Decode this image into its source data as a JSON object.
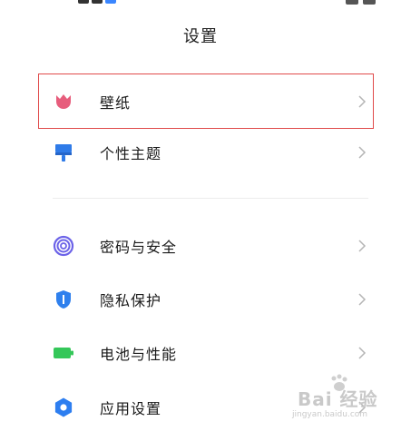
{
  "status_bar": {
    "icons": [
      "signal-icon",
      "app-icon",
      "wifi-icon",
      "battery-icon"
    ]
  },
  "header": {
    "title": "设置"
  },
  "items": [
    {
      "label": "壁纸",
      "icon": "tulip-icon",
      "color": "#e75d7c"
    },
    {
      "label": "个性主题",
      "icon": "brush-icon",
      "color": "#2f7be8"
    },
    {
      "label": "密码与安全",
      "icon": "fingerprint-icon",
      "color": "#6c63e8"
    },
    {
      "label": "隐私保护",
      "icon": "shield-icon",
      "color": "#2f80ed"
    },
    {
      "label": "电池与性能",
      "icon": "battery-icon",
      "color": "#34c759"
    },
    {
      "label": "应用设置",
      "icon": "gear-icon",
      "color": "#2d7ef0"
    }
  ],
  "highlight": {
    "item": "壁纸",
    "color": "#e04a4a"
  },
  "watermark": {
    "main": "Bai 经验",
    "url": "jingyan.baidu.com"
  }
}
